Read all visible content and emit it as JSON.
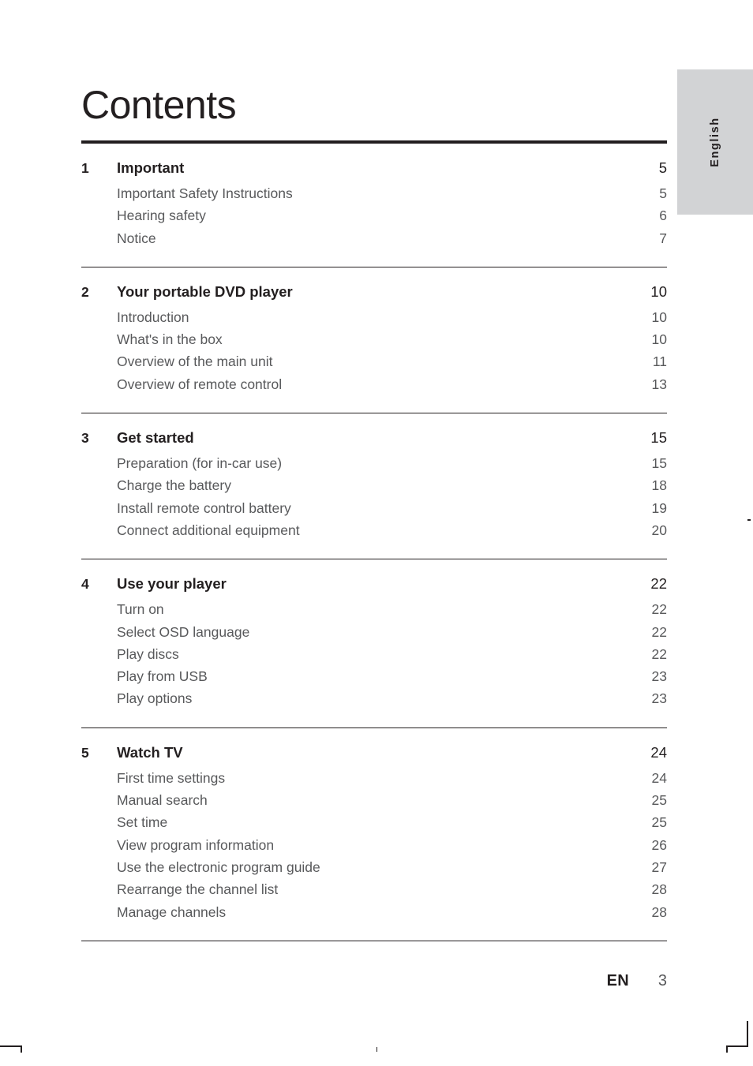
{
  "page": {
    "title": "Contents",
    "language_tab": "English",
    "footer": {
      "language_code": "EN",
      "page_number": "3"
    }
  },
  "toc": {
    "sections": [
      {
        "number": "1",
        "title": "Important",
        "page": "5",
        "entries": [
          {
            "label": "Important Safety Instructions",
            "page": "5"
          },
          {
            "label": "Hearing safety",
            "page": "6"
          },
          {
            "label": "Notice",
            "page": "7"
          }
        ]
      },
      {
        "number": "2",
        "title": "Your portable DVD player",
        "page": "10",
        "entries": [
          {
            "label": "Introduction",
            "page": "10"
          },
          {
            "label": "What's in the box",
            "page": "10"
          },
          {
            "label": "Overview of the main unit",
            "page": "11"
          },
          {
            "label": "Overview of remote control",
            "page": "13"
          }
        ]
      },
      {
        "number": "3",
        "title": "Get started",
        "page": "15",
        "entries": [
          {
            "label": "Preparation (for in-car use)",
            "page": "15"
          },
          {
            "label": "Charge the battery",
            "page": "18"
          },
          {
            "label": "Install remote control battery",
            "page": "19"
          },
          {
            "label": "Connect additional equipment",
            "page": "20"
          }
        ]
      },
      {
        "number": "4",
        "title": "Use your player",
        "page": "22",
        "entries": [
          {
            "label": "Turn on",
            "page": "22"
          },
          {
            "label": "Select OSD language",
            "page": "22"
          },
          {
            "label": "Play discs",
            "page": "22"
          },
          {
            "label": "Play from USB",
            "page": "23"
          },
          {
            "label": "Play options",
            "page": "23"
          }
        ]
      },
      {
        "number": "5",
        "title": "Watch TV",
        "page": "24",
        "entries": [
          {
            "label": "First time settings",
            "page": "24"
          },
          {
            "label": "Manual search",
            "page": "25"
          },
          {
            "label": "Set time",
            "page": "25"
          },
          {
            "label": "View program information",
            "page": "26"
          },
          {
            "label": "Use the electronic program guide",
            "page": "27"
          },
          {
            "label": "Rearrange the channel list",
            "page": "28"
          },
          {
            "label": "Manage channels",
            "page": "28"
          }
        ]
      }
    ]
  }
}
